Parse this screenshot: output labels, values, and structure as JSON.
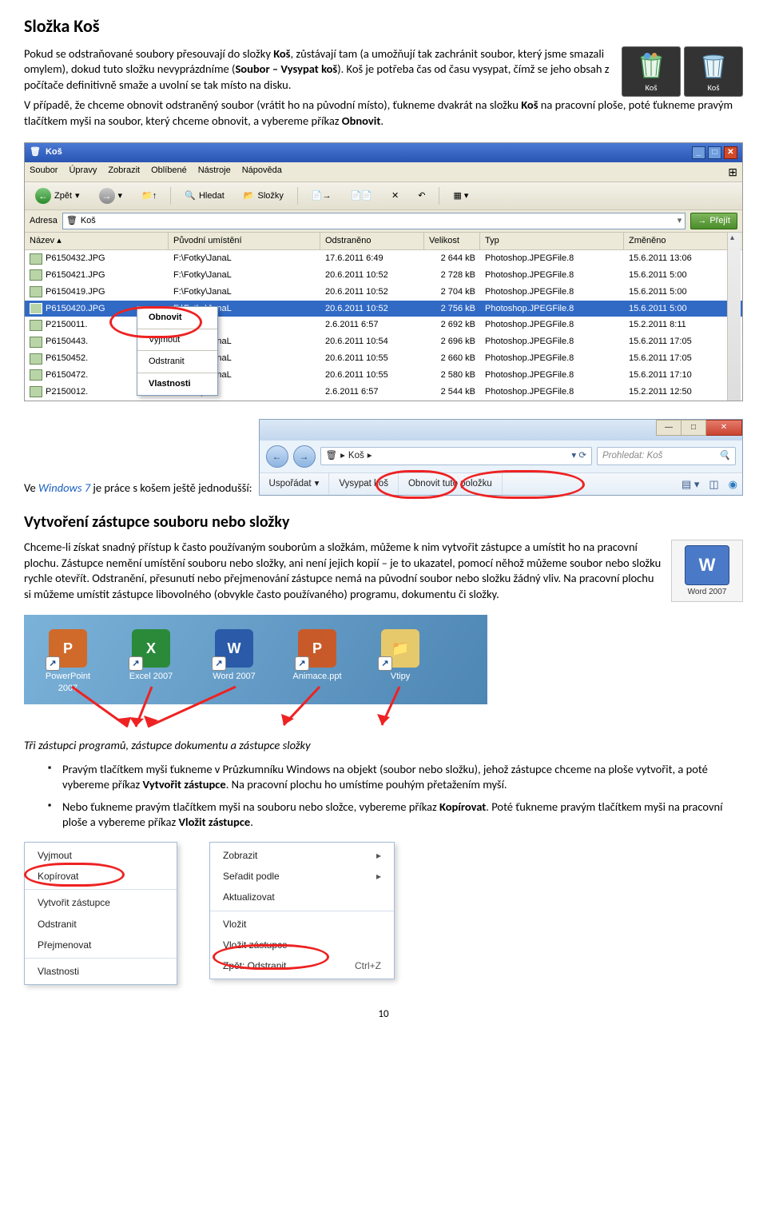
{
  "headings": {
    "h1": "Složka Koš",
    "h2": "Vytvoření zástupce souboru nebo složky"
  },
  "para": {
    "p1a": "Pokud se odstraňované soubory přesouvají do složky ",
    "p1b": ", zůstávají tam (a umožňují tak zachránit soubor, který jsme smazali omylem), dokud tuto složku nevyprázdníme (",
    "p1c": "). Koš je potřeba čas od času vysypat, čímž se jeho obsah z počítače definitivně smaže a uvolní se tak místo na disku.",
    "p1_bold1": "Koš",
    "p1_bold2": "Soubor – Vysypat koš",
    "p2a": "V případě, že chceme obnovit odstraněný soubor (vrátit ho na původní místo), ťukneme dvakrát na složku ",
    "p2b": " na pracovní ploše, poté ťukneme pravým tlačítkem myši na soubor, který chceme obnovit, a vybereme příkaz ",
    "p2c": ".",
    "p2_bold1": "Koš",
    "p2_bold2": "Obnovit",
    "p3a": "Ve ",
    "p3b": " je práce s košem ještě jednodušší:",
    "p3_win": "Windows 7",
    "p4": "Chceme-li získat snadný přístup k často používaným souborům a složkám, můžeme k nim vytvořit zástupce a umístit ho na pracovní plochu. Zástupce nemění umístění souboru nebo složky, ani není jejich kopií – je to ukazatel, pomocí něhož můžeme soubor nebo složku rychle otevřít. Odstranění, přesunutí nebo přejmenování zástupce nemá na původní soubor nebo složku žádný vliv. Na pracovní plochu si můžeme umístit zástupce libovolného (obvykle často používaného) programu, dokumentu či složky.",
    "caption": "Tři zástupci programů, zástupce dokumentu a zástupce složky",
    "li1a": "Pravým tlačítkem myši ťukneme v Průzkumníku Windows na objekt (soubor nebo složku), jehož zástupce chceme na ploše vytvořit, a poté vybereme příkaz ",
    "li1b": ". Na pracovní plochu ho umístíme pouhým přetažením myší.",
    "li1_bold": "Vytvořit zástupce",
    "li2a": "Nebo ťukneme pravým tlačítkem myši na souboru nebo složce, vybereme příkaz ",
    "li2b": ". Poté ťukneme pravým tlačítkem myši na pracovní ploše a vybereme příkaz ",
    "li2c": ".",
    "li2_bold1": "Kopírovat",
    "li2_bold2": "Vložit zástupce"
  },
  "icontiles": {
    "kos": "Koš"
  },
  "winxp": {
    "title": "Koš",
    "menus": [
      "Soubor",
      "Úpravy",
      "Zobrazit",
      "Oblíbené",
      "Nástroje",
      "Nápověda"
    ],
    "tb_back": "Zpět",
    "tb_search": "Hledat",
    "tb_folders": "Složky",
    "addr_label": "Adresa",
    "addr_value": "Koš",
    "go": "Přejít",
    "cols": [
      "Název",
      "Původní umístění",
      "Odstraněno",
      "Velikost",
      "Typ",
      "Změněno"
    ],
    "rows": [
      {
        "name": "P6150432.JPG",
        "path": "F:\\Fotky\\JanaL",
        "del": "17.6.2011 6:49",
        "size": "2 644 kB",
        "type": "Photoshop.JPEGFile.8",
        "mod": "15.6.2011 13:06"
      },
      {
        "name": "P6150421.JPG",
        "path": "F:\\Fotky\\JanaL",
        "del": "20.6.2011 10:52",
        "size": "2 728 kB",
        "type": "Photoshop.JPEGFile.8",
        "mod": "15.6.2011 5:00"
      },
      {
        "name": "P6150419.JPG",
        "path": "F:\\Fotky\\JanaL",
        "del": "20.6.2011 10:52",
        "size": "2 704 kB",
        "type": "Photoshop.JPEGFile.8",
        "mod": "15.6.2011 5:00"
      },
      {
        "name": "P6150420.JPG",
        "path": "F:\\Fotky\\JanaL",
        "del": "20.6.2011 10:52",
        "size": "2 756 kB",
        "type": "Photoshop.JPEGFile.8",
        "mod": "15.6.2011 5:00",
        "sel": true
      },
      {
        "name": "P2150011.",
        "path": "F:\\Fotky",
        "del": "2.6.2011 6:57",
        "size": "2 692 kB",
        "type": "Photoshop.JPEGFile.8",
        "mod": "15.2.2011 8:11"
      },
      {
        "name": "P6150443.",
        "path": "F:\\Fotky\\JanaL",
        "del": "20.6.2011 10:54",
        "size": "2 696 kB",
        "type": "Photoshop.JPEGFile.8",
        "mod": "15.6.2011 17:05"
      },
      {
        "name": "P6150452.",
        "path": "F:\\Fotky\\JanaL",
        "del": "20.6.2011 10:55",
        "size": "2 660 kB",
        "type": "Photoshop.JPEGFile.8",
        "mod": "15.6.2011 17:05"
      },
      {
        "name": "P6150472.",
        "path": "F:\\Fotky\\JanaL",
        "del": "20.6.2011 10:55",
        "size": "2 580 kB",
        "type": "Photoshop.JPEGFile.8",
        "mod": "15.6.2011 17:10"
      },
      {
        "name": "P2150012.",
        "path": "F:\\Fotky",
        "del": "2.6.2011 6:57",
        "size": "2 544 kB",
        "type": "Photoshop.JPEGFile.8",
        "mod": "15.2.2011 12:50"
      }
    ],
    "ctx": {
      "obnovit": "Obnovit",
      "vyjmout": "Vyjmout",
      "odstranit": "Odstranit",
      "vlastnosti": "Vlastnosti"
    }
  },
  "win7": {
    "crumb_sep": "▸",
    "crumb_kos": "Koš",
    "search_placeholder": "Prohledat: Koš",
    "cmd_usporadat": "Uspořádat",
    "cmd_vysypat": "Vysypat koš",
    "cmd_obnovit": "Obnovit tuto položku"
  },
  "desk": {
    "icons": [
      {
        "label": "PowerPoint 2007",
        "color": "#d06a2a",
        "letter": "P"
      },
      {
        "label": "Excel 2007",
        "color": "#2a8a3a",
        "letter": "X"
      },
      {
        "label": "Word 2007",
        "color": "#2a5aa8",
        "letter": "W"
      },
      {
        "label": "Animace.ppt",
        "color": "#c85a2a",
        "letter": "P"
      },
      {
        "label": "Vtipy",
        "color": "#e6c96a",
        "letter": ""
      }
    ]
  },
  "wordicon": {
    "label": "Word 2007",
    "letter": "W"
  },
  "menuA": {
    "items": [
      "Vyjmout",
      "Kopírovat",
      "---",
      "Vytvořit zástupce",
      "Odstranit",
      "Přejmenovat",
      "---",
      "Vlastnosti"
    ]
  },
  "menuB": {
    "items": [
      {
        "t": "Zobrazit",
        "sub": true
      },
      {
        "t": "Seřadit podle",
        "sub": true
      },
      {
        "t": "Aktualizovat"
      },
      {
        "t": "---"
      },
      {
        "t": "Vložit"
      },
      {
        "t": "Vložit zástupce"
      },
      {
        "t": "Zpět: Odstranit",
        "sc": "Ctrl+Z"
      }
    ]
  },
  "pagenum": "10"
}
